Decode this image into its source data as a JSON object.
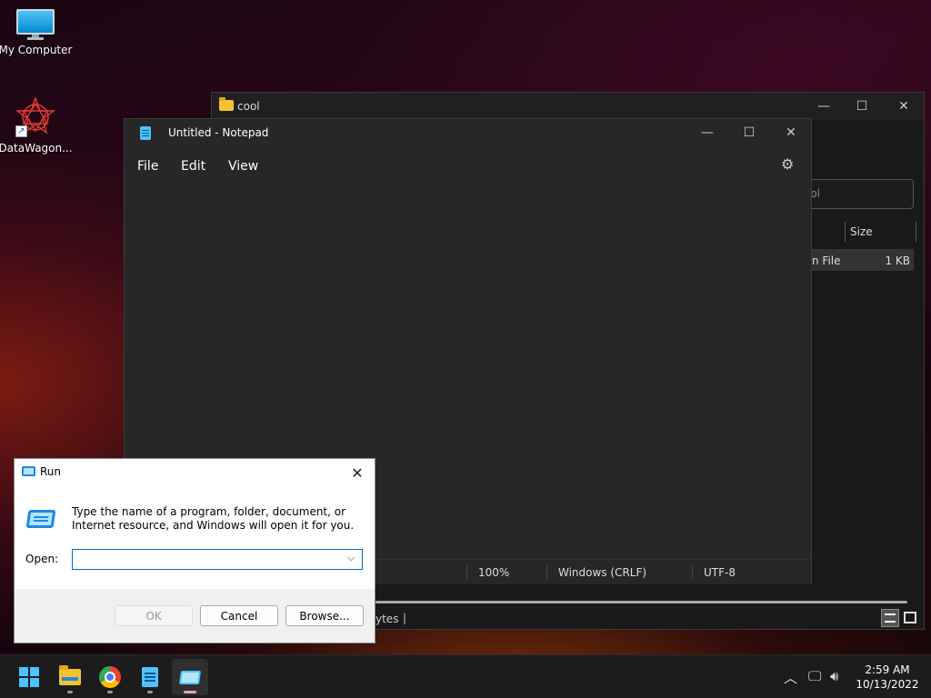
{
  "desktop": {
    "icons": [
      {
        "label": "My Computer"
      },
      {
        "label": "DataWagon..."
      }
    ]
  },
  "explorer": {
    "title": "cool",
    "search_placeholder": "ool",
    "column_size": "Size",
    "row_type": "n File",
    "row_size": "1 KB",
    "status_text": "ytes"
  },
  "notepad": {
    "title": "Untitled - Notepad",
    "menu": {
      "file": "File",
      "edit": "Edit",
      "view": "View"
    },
    "content": "",
    "status": {
      "zoom": "100%",
      "line_ending": "Windows (CRLF)",
      "encoding": "UTF-8"
    }
  },
  "run_dialog": {
    "title": "Run",
    "description": "Type the name of a program, folder, document, or Internet resource, and Windows will open it for you.",
    "open_label": "Open:",
    "open_value": "",
    "buttons": {
      "ok": "OK",
      "cancel": "Cancel",
      "browse": "Browse..."
    }
  },
  "taskbar": {
    "time": "2:59 AM",
    "date": "10/13/2022"
  },
  "colors": {
    "accent": "#0067c0",
    "windows_blue": "#4cc2ff",
    "active_indicator": "#e8a0c8"
  }
}
